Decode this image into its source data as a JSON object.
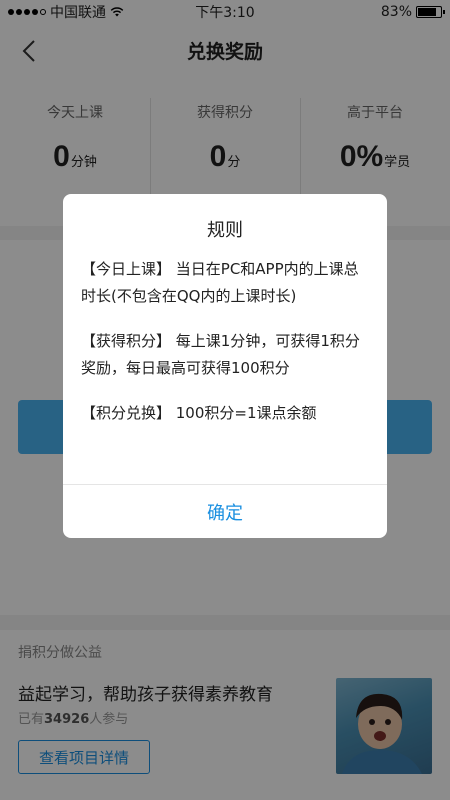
{
  "status_bar": {
    "carrier": "中国联通",
    "time": "下午3:10",
    "battery": "83%",
    "battery_level": 0.83,
    "signal_bars_filled": 4,
    "icons": [
      "signal-icon",
      "wifi-icon",
      "battery-icon"
    ]
  },
  "nav": {
    "title": "兑换奖励",
    "back_icon": "chevron-left-icon"
  },
  "stats": [
    {
      "label": "今天上课",
      "value": "0",
      "unit": "分钟"
    },
    {
      "label": "获得积分",
      "value": "0",
      "unit": "分"
    },
    {
      "label": "高于平台",
      "value": "0%",
      "unit": "学员"
    }
  ],
  "charity": {
    "heading": "捐积分做公益",
    "title": "益起学习，帮助孩子获得素养教育",
    "count_prefix": "已有",
    "count": "34926",
    "count_suffix": "人参与",
    "detail_button": "查看项目详情"
  },
  "modal": {
    "title": "规则",
    "rules": [
      "【今日上课】 当日在PC和APP内的上课总时长(不包含在QQ内的上课时长)",
      "【获得积分】 每上课1分钟，可获得1积分奖励，每日最高可获得100积分",
      "【积分兑换】 100积分=1课点余额"
    ],
    "confirm": "确定"
  },
  "colors": {
    "accent": "#1a8fe0",
    "exchange_button": "#4ab3f0",
    "overlay": "rgba(0,0,0,0.45)"
  }
}
